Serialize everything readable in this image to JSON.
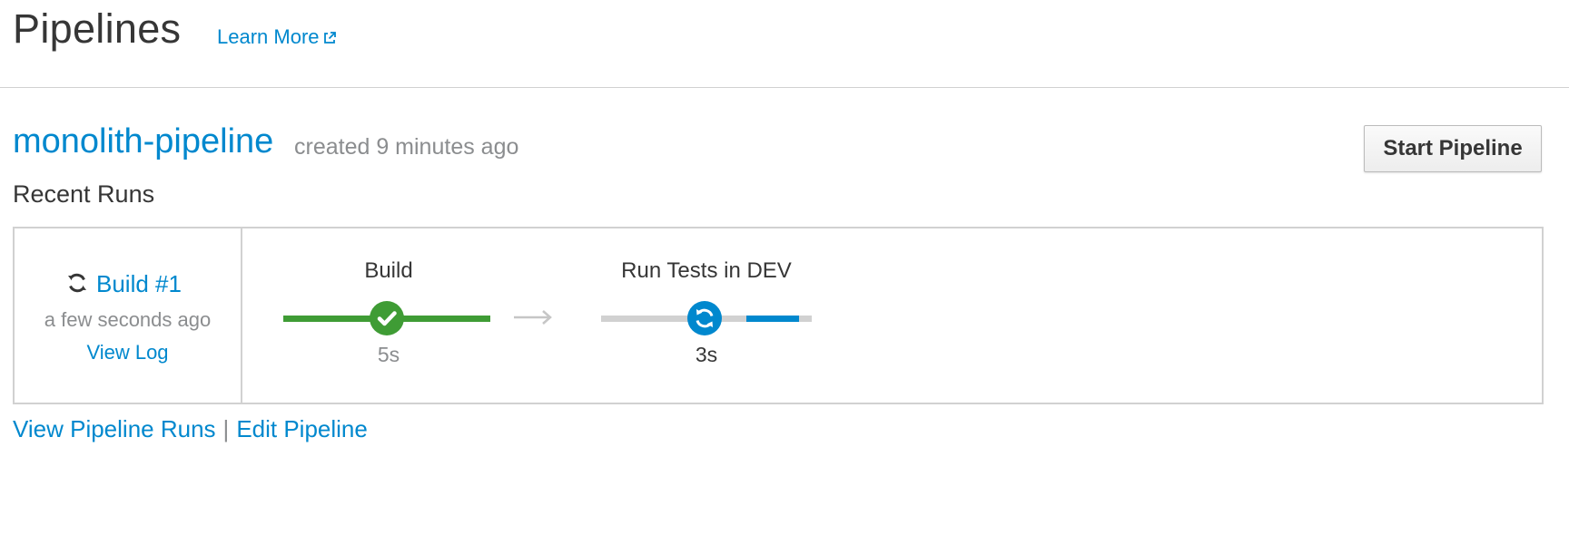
{
  "header": {
    "title": "Pipelines",
    "learn_more": "Learn More",
    "learn_more_icon": "external-link-icon"
  },
  "pipeline": {
    "name": "monolith-pipeline",
    "created": "created 9 minutes ago",
    "start_button": "Start Pipeline",
    "recent_runs_heading": "Recent Runs"
  },
  "run": {
    "label": "Build #1",
    "status_icon": "sync-icon",
    "time": "a few seconds ago",
    "view_log": "View Log"
  },
  "stages": [
    {
      "name": "Build",
      "duration": "5s",
      "status": "complete",
      "status_icon": "check-icon",
      "progress": 1.0,
      "color": "#3f9c35"
    },
    {
      "name": "Run Tests in DEV",
      "duration": "3s",
      "status": "running",
      "status_icon": "sync-icon",
      "progress": 0.5,
      "color": "#0088ce"
    }
  ],
  "footer": {
    "view_runs": "View Pipeline Runs",
    "separator": "|",
    "edit": "Edit Pipeline"
  },
  "colors": {
    "link": "#0088ce",
    "success": "#3f9c35",
    "running": "#0088ce",
    "muted": "#8b8d8f",
    "border": "#d1d1d1"
  }
}
